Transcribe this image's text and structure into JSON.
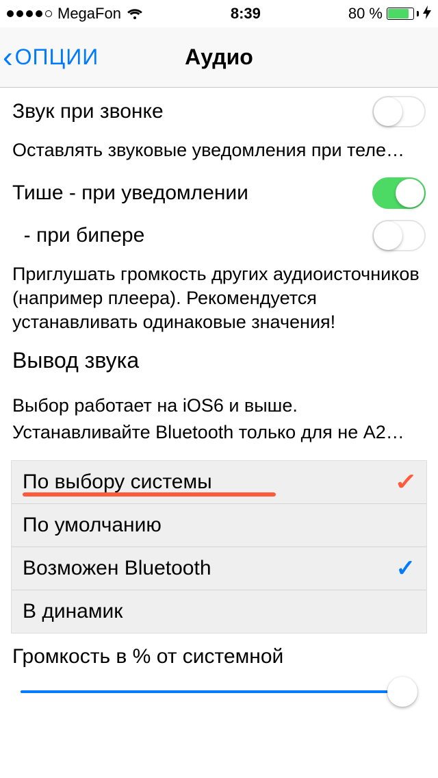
{
  "statusbar": {
    "carrier": "MegaFon",
    "time": "8:39",
    "battery_pct": "80 %"
  },
  "nav": {
    "back": "ОПЦИИ",
    "title": "Аудио"
  },
  "rows": {
    "ring_sound": {
      "label": "Звук при звонке",
      "on": false
    },
    "ring_desc": "Оставлять звуковые уведомления при теле…",
    "quieter_notify": {
      "label": "Тише - при уведомлении",
      "on": true
    },
    "quieter_beep": {
      "label": "  - при бипере",
      "on": false
    },
    "quieter_desc": "Приглушать громкость других аудиоисточников (например плеера). Рекомендуется устанавливать одинаковые значения!"
  },
  "output": {
    "title": "Вывод звука",
    "desc1": "Выбор работает на iOS6 и выше.",
    "desc2": "Устанавливайте Bluetooth только для не A2…",
    "options": [
      {
        "label": "По выбору системы",
        "check": "red",
        "underline": true
      },
      {
        "label": "По умолчанию"
      },
      {
        "label": "Возможен Bluetooth",
        "check": "blue"
      },
      {
        "label": "В динамик"
      }
    ]
  },
  "volume": {
    "title": "Громкость в % от системной",
    "value": 100
  }
}
